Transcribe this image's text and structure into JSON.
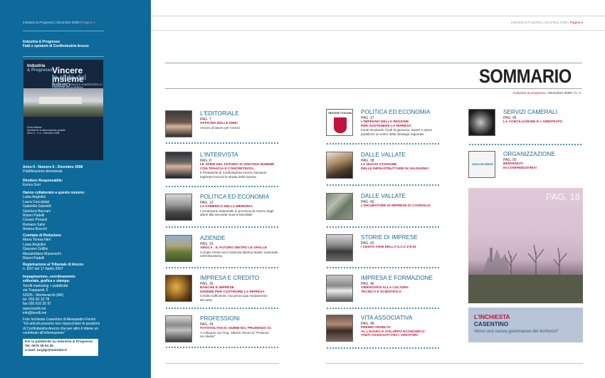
{
  "left": {
    "header_pub": "Industria & Progresso",
    "header_date": "Dicembre 2008",
    "header_page": "Pagina 4",
    "pub_title": "Industria & Progresso",
    "pub_sub": "Fatti e opinioni di Confindustria Arezzo",
    "cover": {
      "brand1": "Industria",
      "brand2": "& Progresso",
      "title1": "Vincere insieme",
      "title2": "le sfide del futuro",
      "tagline": "INNOVAZIONE, TENACIA E CONCRETEZZA: LE STRATEGIE DELLA RIPRESA",
      "c1": "Poste Italiane",
      "c2": "Spedizione in abbonamento postale",
      "c3": "Anno II - n. 6 - Dicembre 2008"
    },
    "issue_line": "Anno II - Numero 6 - Dicembre 2008",
    "issue_sub": "Pubblicazione bimestrale",
    "director_label": "Direttore Responsabile:",
    "director": "Enrico Gori",
    "collab_label": "Hanno collaborato a questo numero:",
    "collaborators": [
      "Luisa Angiolini",
      "Laura Caccialupi",
      "Gabriella Gabrielli",
      "Gianluca Baccani",
      "Rizieri Padelli",
      "Cesare Perazzi",
      "Romano Salvi",
      "Andrea Brocchi"
    ],
    "committee_label": "Comitato di Redazione",
    "committee": [
      "Maria Teresa Neri",
      "Luisa Angiolini",
      "Giacomo Grillini",
      "Massimiliano Mazzeschi",
      "Rizieri Padelli"
    ],
    "reg_label": "Registrazione al Tribunale di Arezzo",
    "reg": "n. 9/07 del 17 Aprile 2007",
    "impag_label1": "Impaginazione, coordinamento",
    "impag_label2": "editoriale, grafica e stampa:",
    "impag_lines": [
      "Torelli marketing + pubblicità",
      "via Traquandi, 5",
      "52025 - Montevarchi (AR)",
      "tel. 055 90 10 78",
      "fax 055 910 35 97",
      "www.torelli.net",
      "info@torelli.net"
    ],
    "photo_lines": [
      "Foto Inchiesta Casentino di Alessandro Ferrini",
      "\"Gli articoli possono non rispecchiare le posizioni",
      "di Confindustria Arezzo che per altro li ritiene un",
      "contributo all'informazione\""
    ],
    "ad_lines": [
      "Per la pubblicità su Industria & Progresso",
      "Tel. 0575 39 94 35",
      "e-mail: targigi@tasindar.it"
    ]
  },
  "right": {
    "header_pub": "Industria & Progresso",
    "header_date": "Dicembre 2008",
    "header_page": "Pagina 5",
    "title": "SOMMARIO",
    "sub_red": "Industria & progresso",
    "sub_rest": " / Dicembre 2008 / ",
    "sub_num": "N. 6"
  },
  "entries": [
    {
      "sec": "L'EDITORIALE",
      "pag": "PAG. 7",
      "red": [
        "OFFICINA DELLE IDEE:"
      ],
      "desc": [
        "Arezzo al lavoro per Arezzo"
      ]
    },
    {
      "sec": "L'INTERVISTA",
      "pag": "PAG. 8",
      "red": [
        "LE SFIDE DEL FUTURO SI VINCONO INSIEME",
        "CON TENACIA E CONCRETEZZA."
      ],
      "desc": [
        "Il Presidente di Confindustria Arezzo Giovanni",
        "Inghirami traccia la strada della ripresa"
      ]
    },
    {
      "sec": "POLITICA ED ECONOMIA",
      "pag": "PAG. 12",
      "red": [
        "LA FABBRICA DELLA MEMORIA"
      ],
      "desc": [
        "L'evoluzione industriale in provincia di Arezzo dagli",
        "albori alla seconda Guerra Mondiale"
      ]
    },
    {
      "sec": "AZIENDE",
      "pag": "PAG. 15",
      "red": [
        "ABOCA : IL FUTURO DIETRO LE SPALLE"
      ],
      "desc": [
        "Compie trenta anni l'azienda tiberina leader nazionale",
        "nell'erboristeria"
      ]
    },
    {
      "sec": "IMPRESA E CREDITO",
      "pag": "PAG. 33",
      "red": [
        "BANCHE E IMPRESE",
        "INSIEME PER COSTRUIRE LA RIPRESA"
      ],
      "desc": [
        "Credito sufficiente, ma preoccupa l'andamento",
        "dei tassi"
      ]
    },
    {
      "sec": "PROFESSIONI",
      "pag": "PAG. 34",
      "red": [
        "FOTOVOLTAICO: DUBBI NO, PRUDENZA SÌ."
      ],
      "desc": [
        "A colloquio con l'Ing. Alberto Veroni di \"Protezio-",
        "ne Utente\""
      ]
    },
    {
      "sec": "POLITICA ED ECONOMIA",
      "pag": "PAG. 37",
      "red": [
        "L'IMPEGNO DELLA REGIONE",
        "PER SOSTENERE LA RIPRESA"
      ],
      "desc": [
        "Fondi strutturali, fondi di garanzia, export e opere",
        "pubbliche al centro della strategia regionale"
      ]
    },
    {
      "sec": "DALLE VALLATE",
      "pag": "PAG. 38",
      "red": [
        "LA NUOVA STAGIONE",
        "DELLE INFRASTRUTTURE IN VALDARNO"
      ],
      "desc": []
    },
    {
      "sec": "DALLE VALLATE",
      "pag": "PAG. 40",
      "red": [
        "L'INCUBATORE DI IMPRESE DI CAVRIGLIA"
      ],
      "desc": []
    },
    {
      "sec": "STORIE DI IMPRESE",
      "pag": "PAG. 42",
      "red": [
        "I CENTO ANNI DELLA S.A.C.F.E.M."
      ],
      "desc": []
    },
    {
      "sec": "IMPRESA E FORMAZIONE",
      "pag": "PAG. 46",
      "red": [
        "ORIENTARSI ALLA CULTURA",
        "TECNICA E SCIENTIFICA"
      ],
      "desc": []
    },
    {
      "sec": "VITA ASSOCIATIVA",
      "pag": "PAG. 48",
      "red": [
        "PREMIO FEDELTA'",
        "AL LAVORO E SVILUPPO ECONOMICO:",
        "TANTI ASSOCIATI FRA I VINCITORI"
      ],
      "desc": []
    },
    {
      "sec": "SERVIZI CAMERALI",
      "pag": "PAG. 49",
      "red": [
        "LA CONCILIAZIONE E L'ARBITRATO"
      ],
      "desc": []
    },
    {
      "sec": "ORGANIZZAZIONE",
      "pag": "PAG. 50",
      "red": [
        "BENVENUTI",
        "IN CONFINDUSTRIA!"
      ],
      "desc": []
    }
  ],
  "thumb_labels": {
    "regione": "REGIONE TOSCANA",
    "carta": "CARTA DEI SERVIZI"
  },
  "feature": {
    "pag": "PAG. 18",
    "l1": "L'INCHIESTA",
    "l2": "CASENTINO",
    "l3": "Verso una nuova governance del territorio?"
  }
}
